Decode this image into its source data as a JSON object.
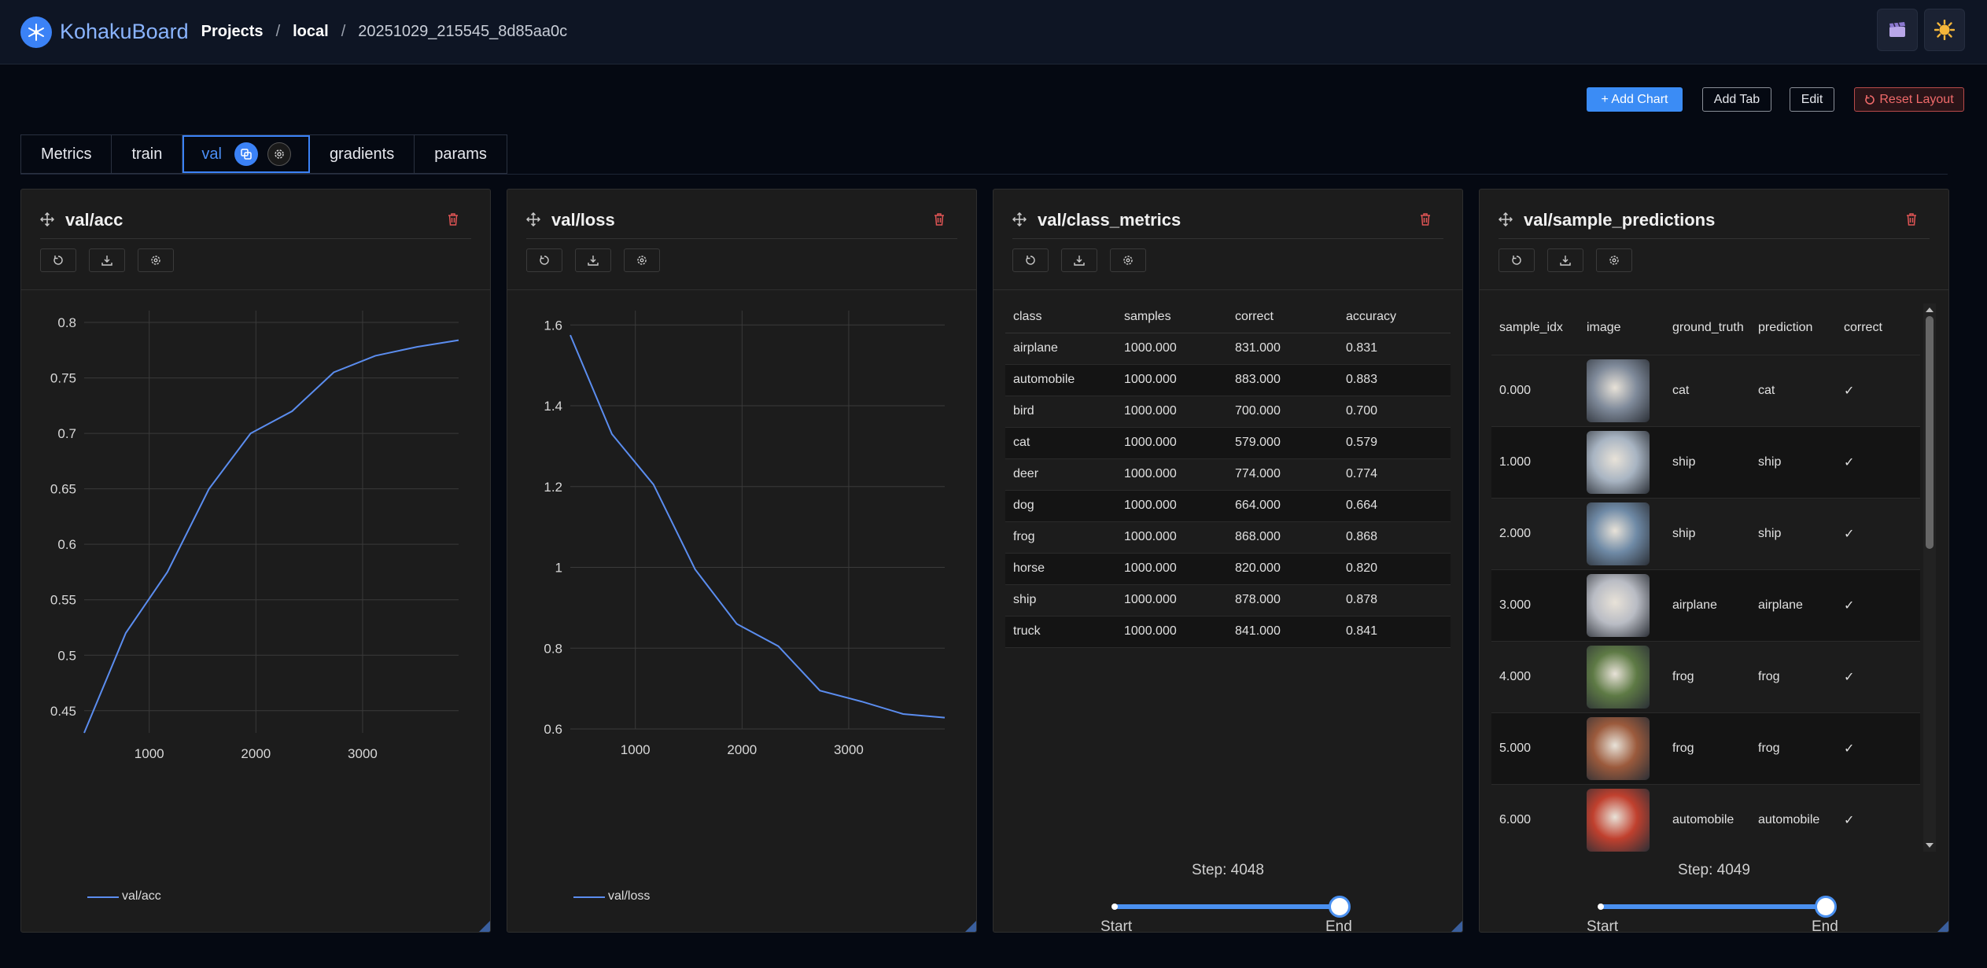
{
  "app": {
    "name": "KohakuBoard"
  },
  "breadcrumb": {
    "projects": "Projects",
    "project": "local",
    "run": "20251029_215545_8d85aa0c"
  },
  "toolbar": {
    "add_chart": "+ Add Chart",
    "add_tab": "Add Tab",
    "edit": "Edit",
    "reset_layout": "Reset Layout"
  },
  "tabs": [
    "Metrics",
    "train",
    "val",
    "gradients",
    "params"
  ],
  "active_tab": "val",
  "colors": {
    "accent": "#3b82f6",
    "line": "#5b8def",
    "danger": "#e05555",
    "card_bg": "#1c1c1c",
    "page_bg": "#050912"
  },
  "panels": {
    "acc": {
      "title": "val/acc",
      "legend": "val/acc"
    },
    "loss": {
      "title": "val/loss",
      "legend": "val/loss"
    },
    "class_metrics": {
      "title": "val/class_metrics",
      "columns": [
        "class",
        "samples",
        "correct",
        "accuracy"
      ],
      "rows": [
        [
          "airplane",
          "1000.000",
          "831.000",
          "0.831"
        ],
        [
          "automobile",
          "1000.000",
          "883.000",
          "0.883"
        ],
        [
          "bird",
          "1000.000",
          "700.000",
          "0.700"
        ],
        [
          "cat",
          "1000.000",
          "579.000",
          "0.579"
        ],
        [
          "deer",
          "1000.000",
          "774.000",
          "0.774"
        ],
        [
          "dog",
          "1000.000",
          "664.000",
          "0.664"
        ],
        [
          "frog",
          "1000.000",
          "868.000",
          "0.868"
        ],
        [
          "horse",
          "1000.000",
          "820.000",
          "0.820"
        ],
        [
          "ship",
          "1000.000",
          "878.000",
          "0.878"
        ],
        [
          "truck",
          "1000.000",
          "841.000",
          "0.841"
        ]
      ],
      "step_label": "Step: 4048",
      "slider_start": "Start",
      "slider_end": "End",
      "slider_range": [
        0,
        1
      ]
    },
    "sample_predictions": {
      "title": "val/sample_predictions",
      "columns": [
        "sample_idx",
        "image",
        "ground_truth",
        "prediction",
        "correct"
      ],
      "rows": [
        {
          "idx": "0.000",
          "image": "cat-photo",
          "color": "#7f8a9a",
          "gt": "cat",
          "pred": "cat",
          "correct": "✓"
        },
        {
          "idx": "1.000",
          "image": "ship-photo",
          "color": "#a8b4c2",
          "gt": "ship",
          "pred": "ship",
          "correct": "✓"
        },
        {
          "idx": "2.000",
          "image": "ship-photo",
          "color": "#6f8aa6",
          "gt": "ship",
          "pred": "ship",
          "correct": "✓"
        },
        {
          "idx": "3.000",
          "image": "airplane-photo",
          "color": "#b9bcc4",
          "gt": "airplane",
          "pred": "airplane",
          "correct": "✓"
        },
        {
          "idx": "4.000",
          "image": "frog-photo",
          "color": "#5e7a45",
          "gt": "frog",
          "pred": "frog",
          "correct": "✓"
        },
        {
          "idx": "5.000",
          "image": "frog-photo",
          "color": "#9b5a3c",
          "gt": "frog",
          "pred": "frog",
          "correct": "✓"
        },
        {
          "idx": "6.000",
          "image": "automobile-photo",
          "color": "#c0402e",
          "gt": "automobile",
          "pred": "automobile",
          "correct": "✓"
        }
      ],
      "step_label": "Step: 4049",
      "slider_start": "Start",
      "slider_end": "End",
      "slider_range": [
        0,
        1
      ]
    }
  },
  "chart_data": [
    {
      "type": "line",
      "title": "val/acc",
      "series": [
        {
          "name": "val/acc",
          "x": [
            390,
            780,
            1170,
            1560,
            1950,
            2340,
            2730,
            3120,
            3510,
            3900
          ],
          "y": [
            0.43,
            0.52,
            0.575,
            0.65,
            0.7,
            0.72,
            0.755,
            0.77,
            0.778,
            0.784
          ]
        }
      ],
      "xlim": [
        390,
        3900
      ],
      "ylim": [
        0.43,
        0.805
      ],
      "xticks": [
        1000,
        2000,
        3000
      ],
      "yticks": [
        0.45,
        0.5,
        0.55,
        0.6,
        0.65,
        0.7,
        0.75,
        0.8
      ],
      "ytick_labels": [
        "0.45",
        "0.5",
        "0.55",
        "0.6",
        "0.65",
        "0.7",
        "0.75",
        "0.8"
      ],
      "grid": true,
      "legend": "bottom-left"
    },
    {
      "type": "line",
      "title": "val/loss",
      "series": [
        {
          "name": "val/loss",
          "x": [
            390,
            780,
            1170,
            1560,
            1950,
            2340,
            2730,
            3120,
            3510,
            3900
          ],
          "y": [
            1.575,
            1.33,
            1.205,
            0.995,
            0.86,
            0.805,
            0.695,
            0.668,
            0.637,
            0.628
          ]
        }
      ],
      "xlim": [
        390,
        3900
      ],
      "ylim": [
        0.6,
        1.62
      ],
      "xticks": [
        1000,
        2000,
        3000
      ],
      "yticks": [
        0.6,
        0.8,
        1.0,
        1.2,
        1.4,
        1.6
      ],
      "ytick_labels": [
        "0.6",
        "0.8",
        "1",
        "1.2",
        "1.4",
        "1.6"
      ],
      "grid": true,
      "legend": "bottom-left"
    }
  ]
}
